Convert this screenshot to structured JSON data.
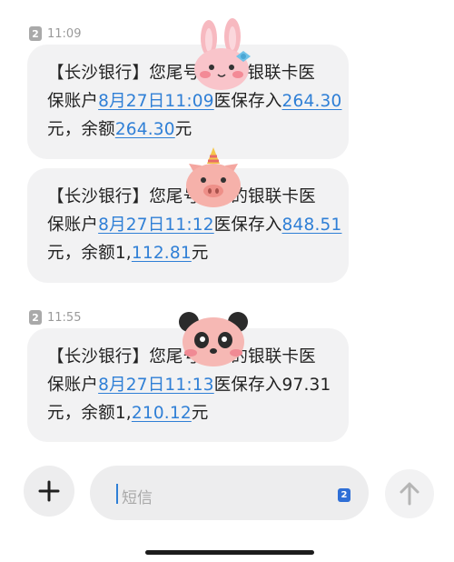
{
  "conversation": {
    "groups": [
      {
        "sim": "2",
        "time": "11:09",
        "message": {
          "bank": "【长沙银行】",
          "line1_tail": "您尾号",
          "line1_end": "银联卡医",
          "line2_prefix": "保账户",
          "datetime": "8月27日11:09",
          "line2_mid": "医保存入",
          "amount": "264.30",
          "line3_prefix": "元，余额",
          "balance_a": "",
          "balance_b": "264.30",
          "line3_suffix": "元"
        }
      },
      {
        "message": {
          "bank": "【长沙银行】",
          "line1_tail": "您尾号",
          "line1_end": "的银联卡医",
          "line2_prefix": "保账户",
          "datetime": "8月27日11:12",
          "line2_mid": "医保存入",
          "amount": "848.51",
          "line3_prefix": "元，余额",
          "balance_a": "1,",
          "balance_b": "112.81",
          "line3_suffix": "元"
        }
      },
      {
        "sim": "2",
        "time": "11:55",
        "message": {
          "bank": "【长沙银行】",
          "line1_tail": "您尾号",
          "line1_end": "的银联卡医",
          "line2_prefix": "保账户",
          "datetime": "8月27日11:13",
          "line2_mid": "医保存入97.31",
          "amount": "",
          "line3_prefix": "元，余额",
          "balance_a": "1,",
          "balance_b": "210.12",
          "line3_suffix": "元"
        }
      }
    ]
  },
  "composer": {
    "placeholder": "短信",
    "sim_badge": "2"
  },
  "icons": {
    "add": "plus-icon",
    "send": "arrow-up-icon",
    "stickers": [
      "bunny-sticker",
      "pig-sticker",
      "panda-sticker"
    ]
  },
  "colors": {
    "link": "#2f7fd6",
    "bubble": "#f2f2f3",
    "timestamp": "#9a9a9a"
  }
}
